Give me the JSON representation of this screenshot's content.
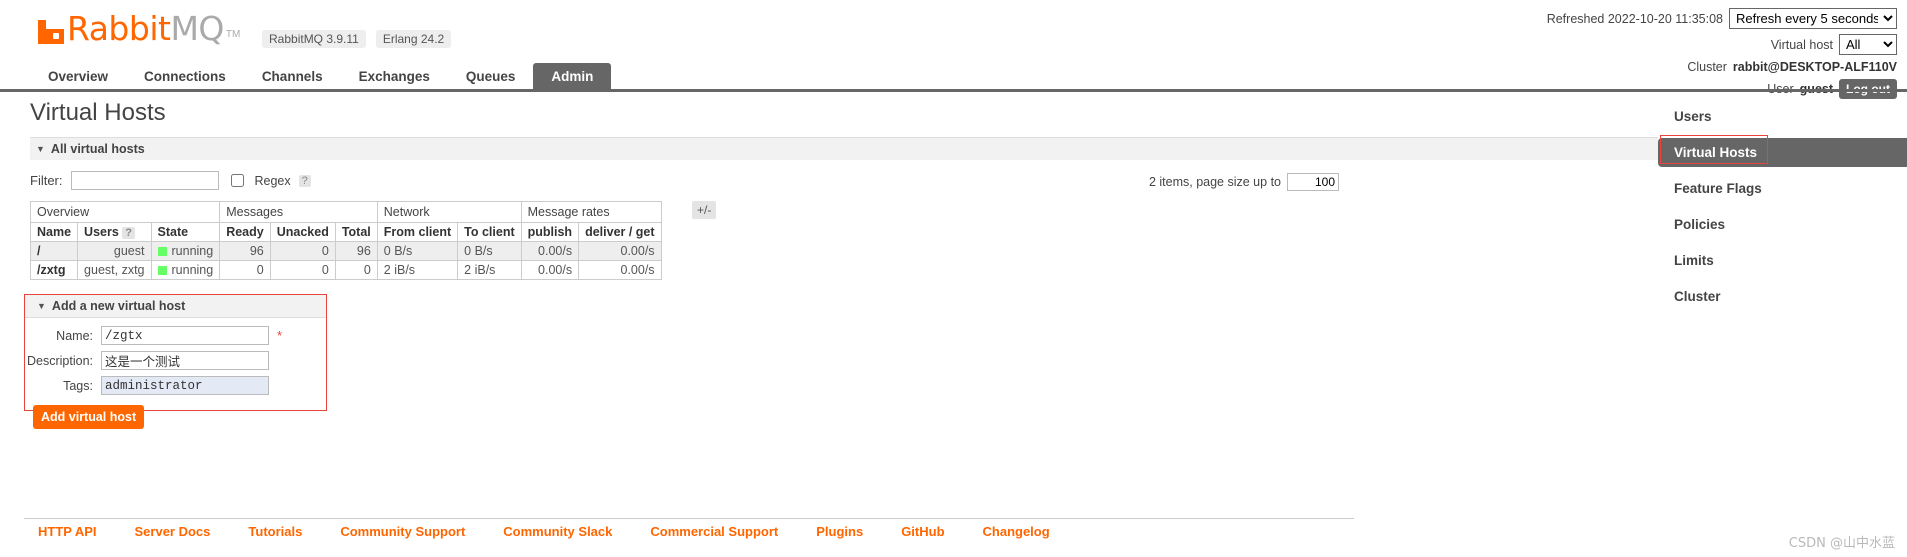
{
  "header": {
    "logo_rabbit": "Rabbit",
    "logo_mq": "MQ",
    "logo_tm": "TM",
    "version_badges": [
      "RabbitMQ 3.9.11",
      "Erlang 24.2"
    ],
    "refreshed_label": "Refreshed 2022-10-20 11:35:08",
    "refresh_select_value": "Refresh every 5 seconds",
    "refresh_options": [
      "Refresh every 5 seconds"
    ],
    "vhost_label": "Virtual host",
    "vhost_select_value": "All",
    "vhost_options": [
      "All"
    ],
    "cluster_label": "Cluster",
    "cluster_name": "rabbit@DESKTOP-ALF110V",
    "user_label": "User",
    "user_name": "guest",
    "logout_label": "Log out"
  },
  "nav": {
    "tabs": [
      {
        "label": "Overview",
        "active": false
      },
      {
        "label": "Connections",
        "active": false
      },
      {
        "label": "Channels",
        "active": false
      },
      {
        "label": "Exchanges",
        "active": false
      },
      {
        "label": "Queues",
        "active": false
      },
      {
        "label": "Admin",
        "active": true
      }
    ]
  },
  "main": {
    "page_title": "Virtual Hosts",
    "section_title": "All virtual hosts",
    "filter_label": "Filter:",
    "filter_value": "",
    "filter_placeholder": "",
    "regex_label": "Regex",
    "regex_help": "?",
    "items_text": "2 items, page size up to",
    "page_size": "100"
  },
  "table": {
    "group_headers": [
      {
        "label": "Overview",
        "span": 3
      },
      {
        "label": "Messages",
        "span": 3
      },
      {
        "label": "Network",
        "span": 2
      },
      {
        "label": "Message rates",
        "span": 2
      }
    ],
    "columns": [
      "Name",
      "Users",
      "State",
      "Ready",
      "Unacked",
      "Total",
      "From client",
      "To client",
      "publish",
      "deliver / get"
    ],
    "users_help": "?",
    "plusminus_label": "+/-",
    "rows": [
      {
        "name": "/",
        "users": "guest",
        "state": "running",
        "ready": "96",
        "unacked": "0",
        "total": "96",
        "from_client": "0 B/s",
        "to_client": "0 B/s",
        "publish": "0.00/s",
        "deliver_get": "0.00/s"
      },
      {
        "name": "/zxtg",
        "users": "guest, zxtg",
        "state": "running",
        "ready": "0",
        "unacked": "0",
        "total": "0",
        "from_client": "2 iB/s",
        "to_client": "2 iB/s",
        "publish": "0.00/s",
        "deliver_get": "0.00/s"
      }
    ]
  },
  "add_form": {
    "title": "Add a new virtual host",
    "name_label": "Name:",
    "name_value": "/zgtx",
    "required_marker": "*",
    "description_label": "Description:",
    "description_value": "这是一个测试",
    "tags_label": "Tags:",
    "tags_value": "administrator",
    "submit_label": "Add virtual host"
  },
  "sidebar": {
    "items": [
      {
        "label": "Users",
        "active": false,
        "highlight": false
      },
      {
        "label": "Virtual Hosts",
        "active": true,
        "highlight": true
      },
      {
        "label": "Feature Flags",
        "active": false,
        "highlight": false
      },
      {
        "label": "Policies",
        "active": false,
        "highlight": false
      },
      {
        "label": "Limits",
        "active": false,
        "highlight": false
      },
      {
        "label": "Cluster",
        "active": false,
        "highlight": false
      }
    ]
  },
  "footer": {
    "links": [
      "HTTP API",
      "Server Docs",
      "Tutorials",
      "Community Support",
      "Community Slack",
      "Commercial Support",
      "Plugins",
      "GitHub",
      "Changelog"
    ],
    "watermark": "CSDN @山中水蓝"
  },
  "colors": {
    "brand_orange": "#ff6600",
    "active_gray": "#666666",
    "status_green": "#66ff66",
    "highlight_red": "#e8443a"
  }
}
